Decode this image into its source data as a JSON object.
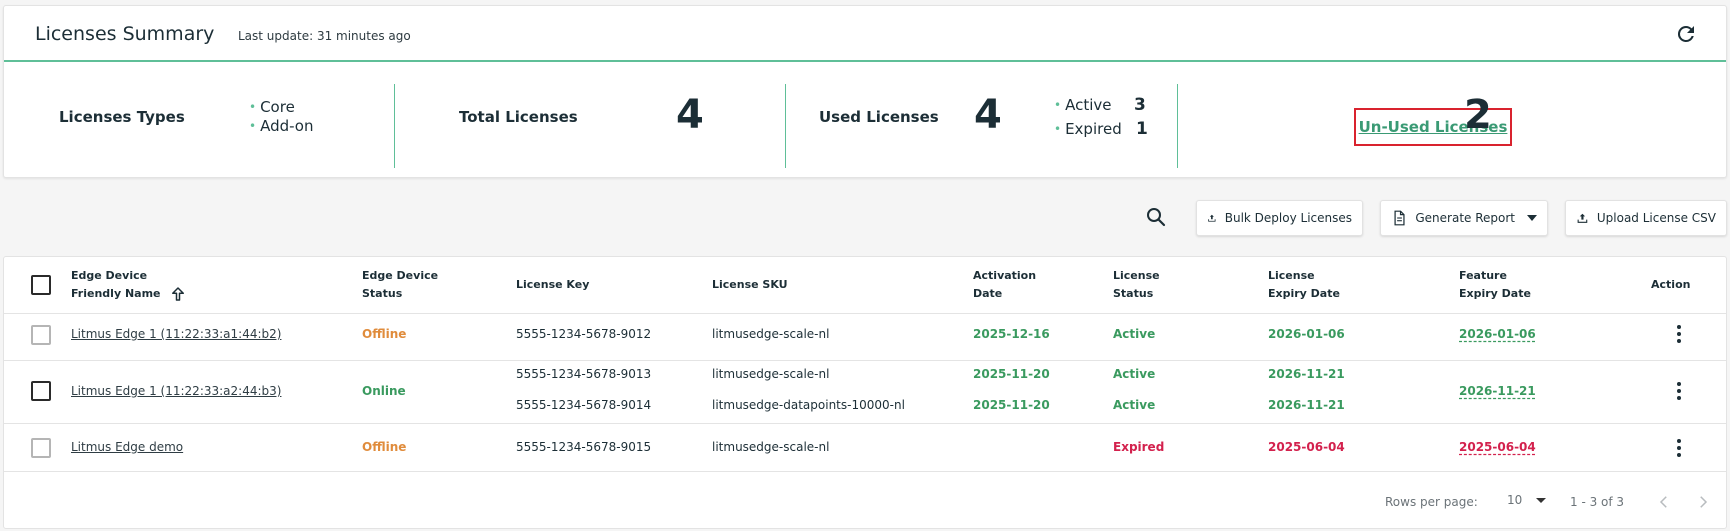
{
  "summary": {
    "title": "Licenses Summary",
    "last_update": "Last update: 31 minutes ago",
    "types_label": "Licenses Types",
    "types": [
      "Core",
      "Add-on"
    ],
    "total_label": "Total Licenses",
    "total_value": "4",
    "used_label": "Used Licenses",
    "used_value": "4",
    "active_label": "Active",
    "active_value": "3",
    "expired_label": "Expired",
    "expired_value": "1",
    "unused_label": "Un-Used Licenses",
    "unused_value": "2"
  },
  "toolbar": {
    "bulk_deploy": "Bulk Deploy Licenses",
    "generate_report": "Generate Report",
    "upload_csv": "Upload License CSV"
  },
  "table": {
    "headers": {
      "device_name_1": "Edge Device",
      "device_name_2": "Friendly Name",
      "status_1": "Edge Device",
      "status_2": "Status",
      "key": "License Key",
      "sku": "License SKU",
      "activation_1": "Activation",
      "activation_2": "Date",
      "lstatus_1": "License",
      "lstatus_2": "Status",
      "lexpiry_1": "License",
      "lexpiry_2": "Expiry Date",
      "fexpiry_1": "Feature",
      "fexpiry_2": "Expiry Date",
      "action": "Action"
    },
    "rows": [
      {
        "name": "Litmus Edge 1 (11:22:33:a1:44:b2)",
        "status": "Offline",
        "keys": [
          "5555-1234-5678-9012"
        ],
        "skus": [
          "litmusedge-scale-nl"
        ],
        "activation": [
          "2025-12-16"
        ],
        "lstatus": [
          "Active"
        ],
        "lexpiry": [
          "2026-01-06"
        ],
        "fexpiry": "2026-01-06"
      },
      {
        "name": "Litmus Edge 1 (11:22:33:a2:44:b3)",
        "status": "Online",
        "keys": [
          "5555-1234-5678-9013",
          "5555-1234-5678-9014"
        ],
        "skus": [
          "litmusedge-scale-nl",
          "litmusedge-datapoints-10000-nl"
        ],
        "activation": [
          "2025-11-20",
          "2025-11-20"
        ],
        "lstatus": [
          "Active",
          "Active"
        ],
        "lexpiry": [
          "2026-11-21",
          "2026-11-21"
        ],
        "fexpiry": "2026-11-21"
      },
      {
        "name": "Litmus Edge demo",
        "status": "Offline",
        "keys": [
          "5555-1234-5678-9015"
        ],
        "skus": [
          "litmusedge-scale-nl"
        ],
        "activation": [],
        "lstatus": [
          "Expired"
        ],
        "lexpiry": [
          "2025-06-04"
        ],
        "fexpiry": "2025-06-04"
      }
    ]
  },
  "pagination": {
    "rows_per_page_label": "Rows per page:",
    "rows_per_page": "10",
    "range": "1 - 3 of 3"
  },
  "colors": {
    "accent": "#5fbf98",
    "active": "#3a9a5f",
    "offline": "#e08c3c",
    "expired": "#d3214d",
    "highlight_border": "#d9232e"
  }
}
